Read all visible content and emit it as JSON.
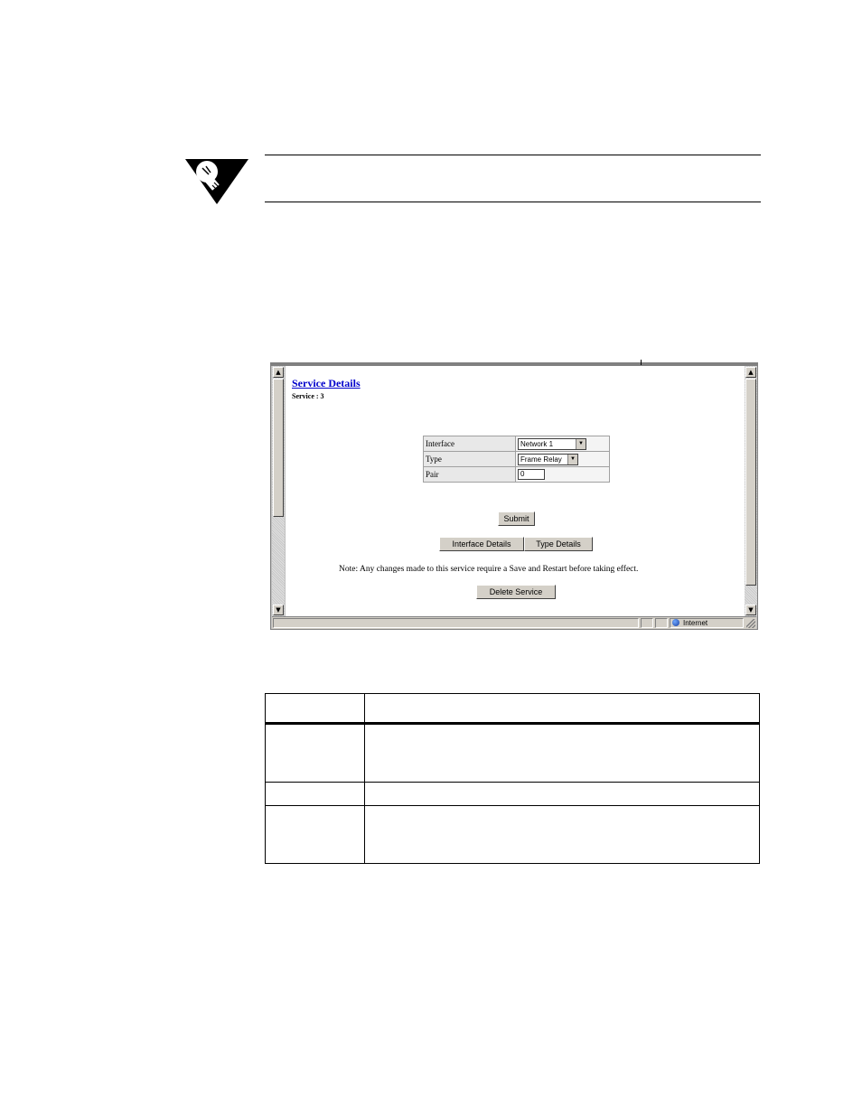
{
  "browser": {
    "page_title": "Service Details",
    "page_subtitle": "Service : 3",
    "form": {
      "rows": [
        {
          "label": "Interface",
          "value": "Network 1",
          "control": "select"
        },
        {
          "label": "Type",
          "value": "Frame Relay",
          "control": "select"
        },
        {
          "label": "Pair",
          "value": "0",
          "control": "input"
        }
      ]
    },
    "buttons": {
      "submit": "Submit",
      "interface_details": "Interface Details",
      "type_details": "Type Details",
      "delete_service": "Delete Service"
    },
    "note": "Note:  Any changes made to this service require a Save and Restart before taking effect.",
    "statusbar": {
      "zone": "Internet"
    }
  },
  "description_table": {
    "headers": [
      "",
      ""
    ],
    "rows": [
      [
        "",
        ""
      ],
      [
        "",
        ""
      ],
      [
        "",
        ""
      ]
    ]
  },
  "icons": {
    "note": "lightbulb-note-icon",
    "zone": "globe-icon",
    "dropdown": "chevron-down-icon"
  }
}
